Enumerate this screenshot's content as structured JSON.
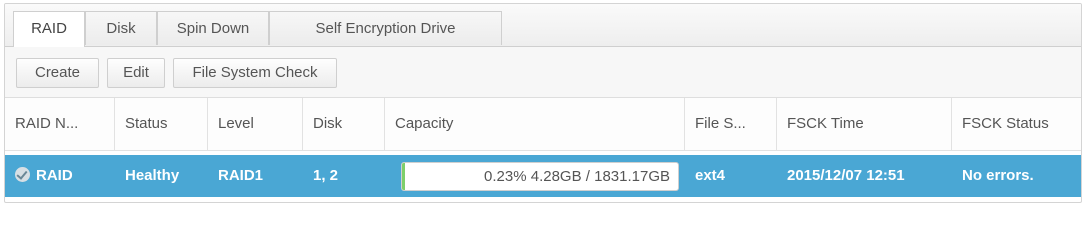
{
  "tabs": [
    {
      "label": "RAID",
      "active": true
    },
    {
      "label": "Disk",
      "active": false
    },
    {
      "label": "Spin Down",
      "active": false
    },
    {
      "label": "Self Encryption Drive",
      "active": false
    }
  ],
  "toolbar": {
    "create_label": "Create",
    "edit_label": "Edit",
    "fsck_label": "File System Check"
  },
  "table": {
    "headers": [
      "RAID N...",
      "Status",
      "Level",
      "Disk",
      "Capacity",
      "File S...",
      "FSCK Time",
      "FSCK Status"
    ],
    "rows": [
      {
        "name": "RAID",
        "status": "Healthy",
        "level": "RAID1",
        "disk": "1, 2",
        "capacity_text": "0.23%  4.28GB / 1831.17GB",
        "capacity_fraction": 0.0023,
        "filesystem": "ext4",
        "fsck_time": "2015/12/07 12:51",
        "fsck_status": "No errors.",
        "selected": true
      }
    ]
  },
  "colors": {
    "selected_row": "#4aa7d4",
    "capacity_fill": "#7fcf6a"
  },
  "icons": {
    "status": "check-circle-icon"
  }
}
